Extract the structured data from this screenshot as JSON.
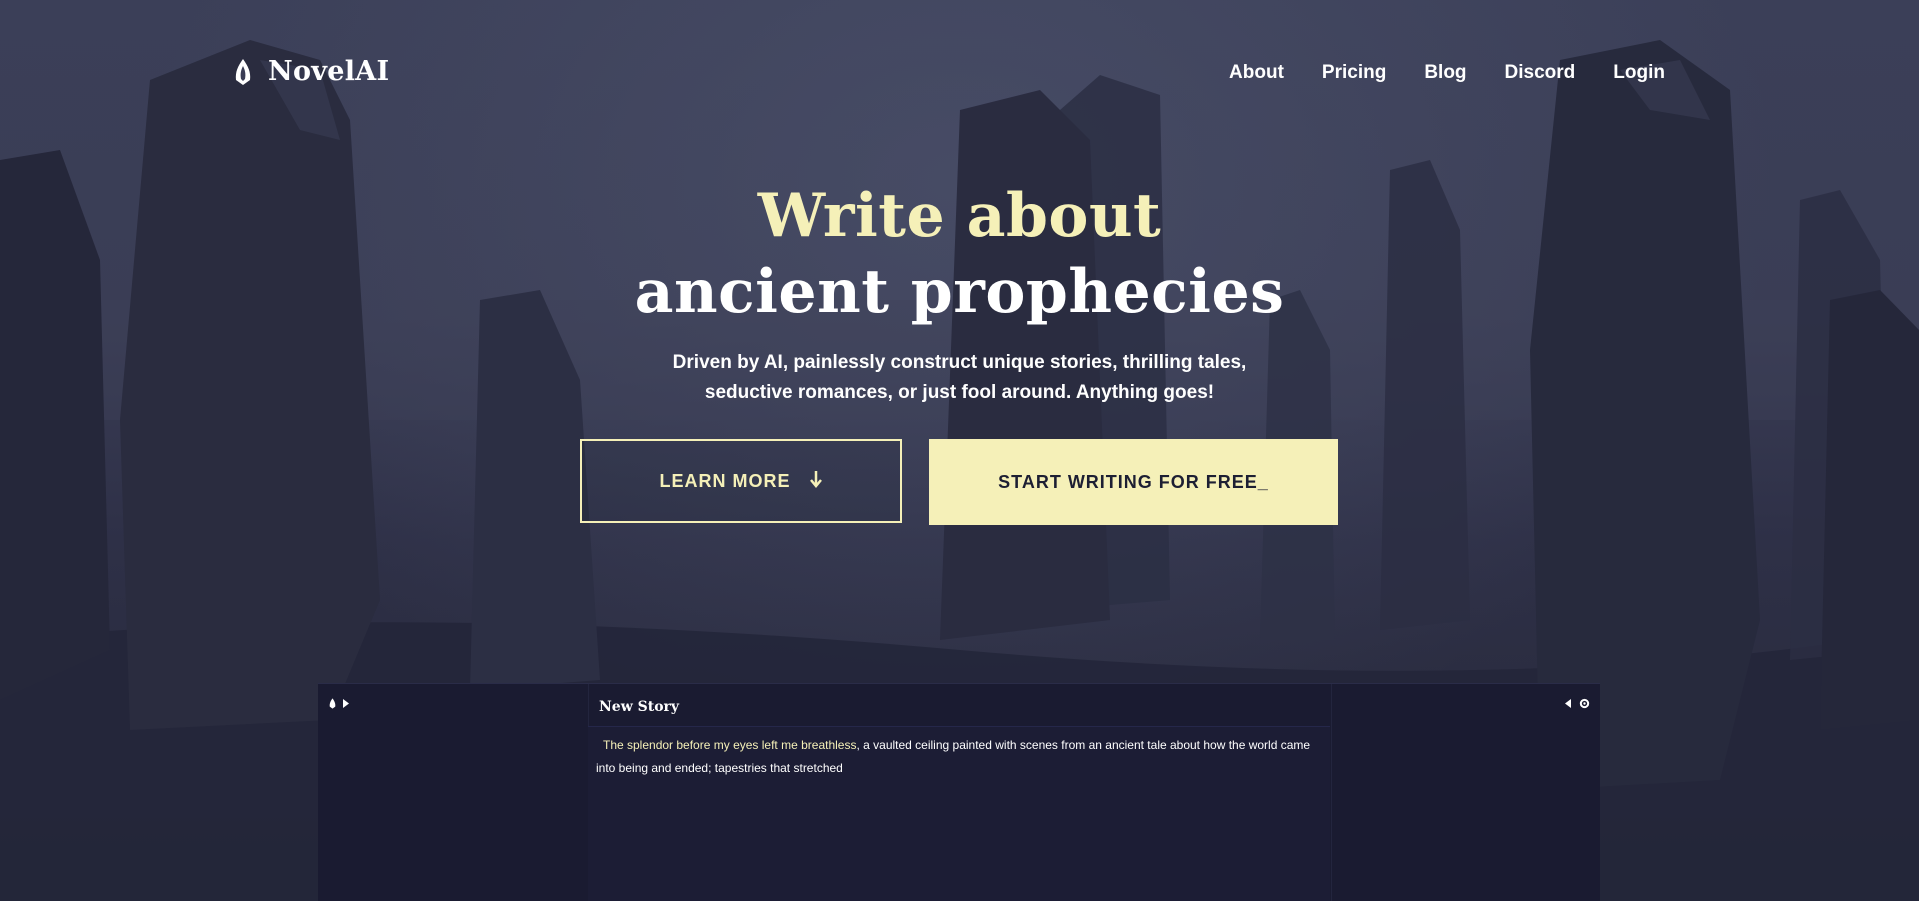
{
  "nav": {
    "brand": "NovelAI",
    "links": [
      "About",
      "Pricing",
      "Blog",
      "Discord",
      "Login"
    ]
  },
  "hero": {
    "title_accent": "Write about",
    "title_main": "ancient prophecies",
    "subtitle": "Driven by AI, painlessly construct unique stories, thrilling tales, seductive romances, or just fool around. Anything goes!"
  },
  "buttons": {
    "learn_more": "LEARN MORE",
    "start_writing": "START WRITING FOR FREE_"
  },
  "preview": {
    "story_title": "New Story",
    "highlighted_text": "The splendor before my eyes left me breathless",
    "body_text": ", a vaulted ceiling painted with scenes from an ancient tale about how the world came into being and ended; tapestries that stretched"
  },
  "colors": {
    "accent": "#f5f0b8",
    "background": "#2a2d42",
    "panel": "#1a1b31",
    "button_text_dark": "#1d1f33"
  },
  "icons": {
    "logo": "novelai-quill-icon",
    "learn_more_arrow": "arrow-down-icon",
    "preview_left": [
      "novelai-logo-icon",
      "chevron-right-icon"
    ],
    "preview_right": [
      "chevron-left-icon",
      "gear-icon"
    ]
  }
}
